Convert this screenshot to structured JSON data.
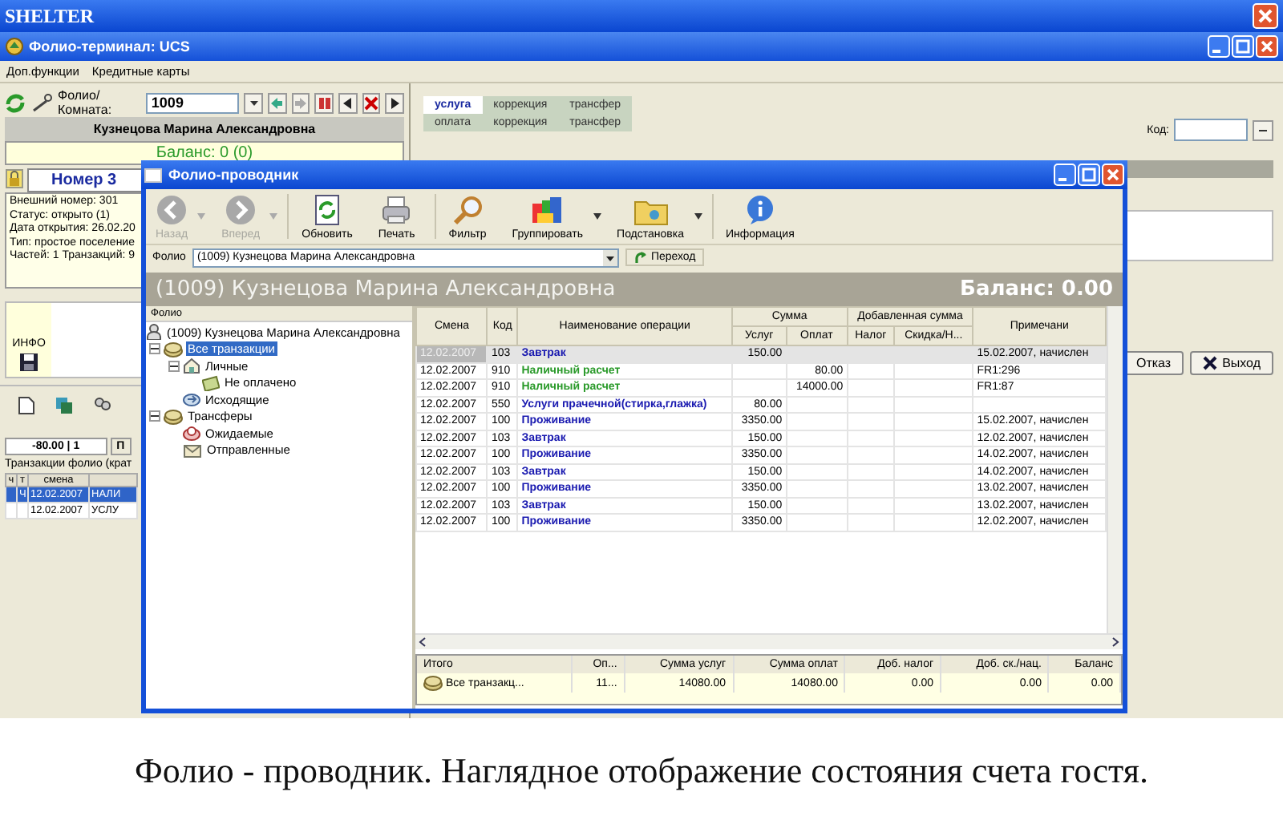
{
  "app": {
    "title": "SHELTER"
  },
  "terminal": {
    "title": "Фолио-терминал: UCS",
    "menu": [
      "Доп.функции",
      "Кредитные карты"
    ],
    "room_label": "Фолио/Комната:",
    "room_value": "1009",
    "guest_name": "Кузнецова Марина Александровна",
    "balance": "Баланс: 0 (0)",
    "room_header": "Номер 3",
    "info_lines": [
      "Внешний номер: 301",
      "Статус: открыто (1)",
      "Дата открытия: 26.02.20",
      "Тип: простое поселение",
      "Частей: 1 Транзакций: 9"
    ],
    "info_label": "ИНФО",
    "tabs": [
      {
        "label": "-80.00 | 1",
        "selected": true
      },
      {
        "label": "П",
        "selected": false
      }
    ],
    "transactions_title": "Транзакции фолио (крат",
    "transaction_columns": [
      "ч",
      "т",
      "смена"
    ],
    "transactions": [
      {
        "type": "Ч",
        "date": "12.02.2007",
        "name": "НАЛИ",
        "selected": true
      },
      {
        "date": "12.02.2007",
        "name": "УСЛУ",
        "selected": false
      }
    ],
    "entry_tabs": [
      [
        {
          "label": "услуга",
          "selected": true
        },
        {
          "label": "коррекция",
          "selected": false
        },
        {
          "label": "трансфер",
          "selected": false
        }
      ],
      [
        {
          "label": "оплата",
          "selected": false
        },
        {
          "label": "коррекция",
          "selected": false
        },
        {
          "label": "трансфер",
          "selected": false
        }
      ]
    ],
    "code_label": "Код:",
    "buttons": [
      {
        "label": "Отказ",
        "kind": "plain"
      },
      {
        "label": "Выход",
        "kind": "exit"
      }
    ]
  },
  "folio_window": {
    "title": "Фолио-проводник",
    "toolbar": [
      {
        "label": "Назад",
        "kind": "back",
        "disabled": true,
        "dropdown": true
      },
      {
        "label": "Вперед",
        "kind": "forward",
        "disabled": true,
        "dropdown": true
      },
      {
        "label": "Обновить",
        "kind": "refresh",
        "disabled": false,
        "dropdown": false
      },
      {
        "label": "Печать",
        "kind": "print",
        "disabled": false,
        "dropdown": false
      },
      {
        "label": "Фильтр",
        "kind": "filter",
        "disabled": false,
        "dropdown": false
      },
      {
        "label": "Группировать",
        "kind": "group",
        "disabled": false,
        "dropdown": true
      },
      {
        "label": "Подстановка",
        "kind": "folder",
        "disabled": false,
        "dropdown": true
      },
      {
        "label": "Информация",
        "kind": "info",
        "disabled": false,
        "dropdown": false
      }
    ],
    "folio_label": "Фолио",
    "folio_value": "(1009) Кузнецова Марина Александровна",
    "go_button": "Переход",
    "header_name": "(1009) Кузнецова Марина Александровна",
    "header_balance": "Баланс: 0.00",
    "tree_title": "Фолио",
    "tree": [
      {
        "label": "(1009) Кузнецова Марина Александровна",
        "kind": "guest",
        "selected": false,
        "children": [
          {
            "label": "Все транзакции",
            "kind": "coins",
            "selected": true,
            "expanded": true,
            "children": [
              {
                "label": "Личные",
                "kind": "home",
                "selected": false,
                "expanded": true,
                "children": [
                  {
                    "label": "Не оплачено",
                    "kind": "money",
                    "selected": false
                  }
                ]
              },
              {
                "label": "Исходящие",
                "kind": "outgoing",
                "selected": false
              }
            ]
          },
          {
            "label": "Трансферы",
            "kind": "coins",
            "selected": false,
            "expanded": true,
            "children": [
              {
                "label": "Ожидаемые",
                "kind": "expected",
                "selected": false
              },
              {
                "label": "Отправленные",
                "kind": "sent",
                "selected": false
              }
            ]
          }
        ]
      }
    ],
    "table": {
      "columns": [
        {
          "label": "Смена"
        },
        {
          "label": "Код"
        },
        {
          "label": "Наименование операции"
        },
        {
          "label": "Сумма",
          "children": [
            "Услуг",
            "Оплат"
          ]
        },
        {
          "label": "Добавленная сумма",
          "children": [
            "Налог",
            "Скидка/Н..."
          ]
        },
        {
          "label": "Примечани"
        }
      ],
      "rows": [
        {
          "date": "12.02.2007",
          "code": "103",
          "name": "Завтрак",
          "kind": "charge",
          "services": "150.00",
          "note": "15.02.2007, начислен",
          "selected": true
        },
        {
          "date": "12.02.2007",
          "code": "910",
          "name": "Наличный расчет",
          "kind": "payment",
          "payments": "80.00",
          "note": "FR1:296",
          "selected": false
        },
        {
          "date": "12.02.2007",
          "code": "910",
          "name": "Наличный расчет",
          "kind": "payment",
          "payments": "14000.00",
          "note": "FR1:87",
          "selected": false
        },
        {
          "date": "12.02.2007",
          "code": "550",
          "name": "Услуги прачечной(стирка,глажка)",
          "kind": "charge",
          "services": "80.00",
          "selected": false
        },
        {
          "date": "12.02.2007",
          "code": "100",
          "name": "Проживание",
          "kind": "charge",
          "services": "3350.00",
          "note": "15.02.2007, начислен",
          "selected": false
        },
        {
          "date": "12.02.2007",
          "code": "103",
          "name": "Завтрак",
          "kind": "charge",
          "services": "150.00",
          "note": "12.02.2007, начислен",
          "selected": false
        },
        {
          "date": "12.02.2007",
          "code": "100",
          "name": "Проживание",
          "kind": "charge",
          "services": "3350.00",
          "note": "14.02.2007, начислен",
          "selected": false
        },
        {
          "date": "12.02.2007",
          "code": "103",
          "name": "Завтрак",
          "kind": "charge",
          "services": "150.00",
          "note": "14.02.2007, начислен",
          "selected": false
        },
        {
          "date": "12.02.2007",
          "code": "100",
          "name": "Проживание",
          "kind": "charge",
          "services": "3350.00",
          "note": "13.02.2007, начислен",
          "selected": false
        },
        {
          "date": "12.02.2007",
          "code": "103",
          "name": "Завтрак",
          "kind": "charge",
          "services": "150.00",
          "note": "13.02.2007, начислен",
          "selected": false
        },
        {
          "date": "12.02.2007",
          "code": "100",
          "name": "Проживание",
          "kind": "charge",
          "services": "3350.00",
          "note": "12.02.2007, начислен",
          "selected": false
        }
      ]
    },
    "totals": {
      "columns": [
        "Итого",
        "Оп...",
        "Сумма услуг",
        "Сумма оплат",
        "Доб. налог",
        "Доб. ск./нац.",
        "Баланс"
      ],
      "row": [
        "Все транзакц...",
        "11...",
        "14080.00",
        "14080.00",
        "0.00",
        "0.00",
        "0.00"
      ]
    }
  },
  "caption": "Фолио - проводник. Наглядное отображение состояния счета гостя."
}
